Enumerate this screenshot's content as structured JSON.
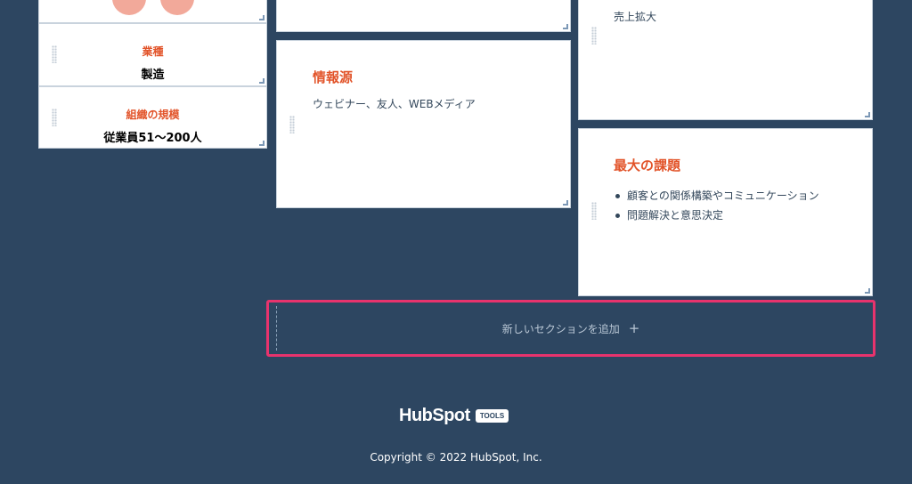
{
  "left_panel": {
    "industry_label": "業種",
    "industry_value": "製造",
    "size_label": "組織の規模",
    "size_value": "従業員51〜200人"
  },
  "info_source_card": {
    "title": "情報源",
    "text": "ウェビナー、友人、WEBメディア"
  },
  "top_right_card": {
    "text": "売上拡大"
  },
  "challenge_card": {
    "title": "最大の課題",
    "items": [
      "顧客との関係構築やコミュニケーション",
      "問題解決と意思決定"
    ]
  },
  "add_section": {
    "label": "新しいセクションを追加",
    "icon": "plus-icon"
  },
  "footer": {
    "logo_word": "HubSpot",
    "logo_tag": "TOOLS",
    "copyright": "Copyright © 2022 HubSpot, Inc."
  },
  "colors": {
    "background": "#2d4661",
    "accent_orange": "#e2542a",
    "highlight_border": "#e8336d"
  }
}
